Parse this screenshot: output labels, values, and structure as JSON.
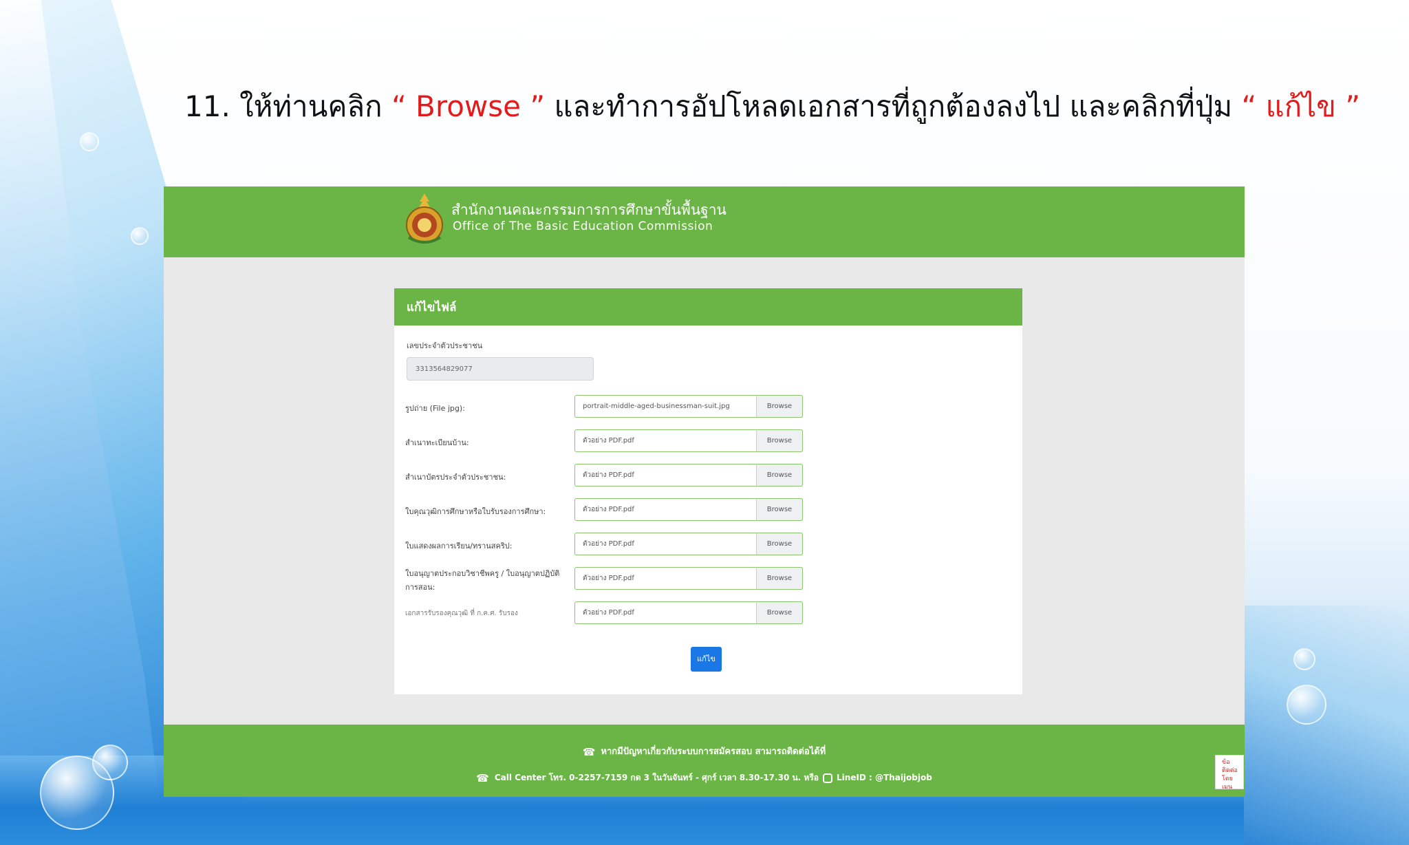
{
  "instruction": {
    "prefix": "11. ให้ท่านคลิก ",
    "highlight1": "“ Browse ”",
    "middle": " และทำการอัปโหลดเอกสารที่ถูกต้องลงไป และคลิกที่ปุ่ม ",
    "highlight2": "“ แก้ไข ”"
  },
  "header": {
    "org_th": "สำนักงานคณะกรรมการการศึกษาขั้นพื้นฐาน",
    "org_en": "Office of The Basic Education Commission",
    "emblem_icon": "obec-emblem-icon"
  },
  "card": {
    "title": "แก้ไขไฟล์",
    "id_label": "เลขประจำตัวประชาชน",
    "id_value": "3313564829077",
    "browse_label": "Browse",
    "rows": [
      {
        "label": "รูปถ่าย (File jpg):",
        "value": "portrait-middle-aged-businessman-suit.jpg"
      },
      {
        "label": "สำเนาทะเบียนบ้าน:",
        "value": "ตัวอย่าง PDF.pdf"
      },
      {
        "label": "สำเนาบัตรประจำตัวประชาชน:",
        "value": "ตัวอย่าง PDF.pdf"
      },
      {
        "label": "ใบคุณวุฒิการศึกษาหรือใบรับรองการศึกษา:",
        "value": "ตัวอย่าง PDF.pdf"
      },
      {
        "label": "ใบแสดงผลการเรียน/ทรานสคริป:",
        "value": "ตัวอย่าง PDF.pdf"
      },
      {
        "label": "ใบอนุญาตประกอบวิชาชีพครู / ใบอนุญาตปฏิบัติการสอน:",
        "value": "ตัวอย่าง PDF.pdf"
      },
      {
        "label": "เอกสารรับรองคุณวุฒิ ที่ ก.ค.ศ. รับรอง",
        "value": "ตัวอย่าง PDF.pdf"
      }
    ],
    "submit_label": "แก้ไข"
  },
  "footer": {
    "line1": "หากมีปัญหาเกี่ยวกับระบบการสมัครสอบ สามารถติดต่อได้ที่",
    "line2a": "Call Center โทร. 0-2257-7159 กด 3 ในวันจันทร์ - ศุกร์ เวลา 8.30-17.30 น. หรือ",
    "line2b": "LineID : @Thaijobjob",
    "phone_icon": "phone-icon",
    "line_icon": "line-app-icon"
  },
  "contact_tab": "ข้อติดต่อ โดยเมนู ไซต์",
  "colors": {
    "green": "#6ab545",
    "blue_button": "#1a77e6",
    "highlight_red": "#e31b1b"
  }
}
